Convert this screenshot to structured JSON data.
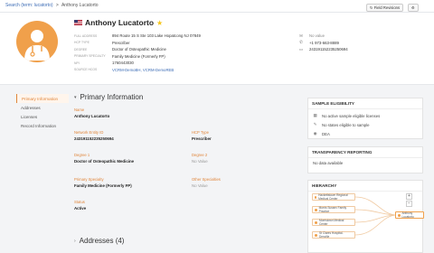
{
  "breadcrumb": {
    "search_link": "Search (term: lucatorto)",
    "separator": ">",
    "current": "Anthony Lucatorto"
  },
  "toolbar": {
    "field_revisions": "Field Revisions",
    "settings_icon": "gear-icon"
  },
  "profile": {
    "name": "Anthony Lucatorto",
    "info": [
      {
        "label": "Full Address",
        "value": "894 Route 15 S Ste 103 Lake Hopatcong NJ 07849",
        "link": false
      },
      {
        "label": "HCP Type",
        "value": "Prescriber",
        "link": false
      },
      {
        "label": "Degree",
        "value": "Doctor of Osteopathic Medicine",
        "link": false
      },
      {
        "label": "Primary Specialty",
        "value": "Family Medicine (Formerly FP)",
        "link": false
      },
      {
        "label": "NPI",
        "value": "1760443030",
        "link": false
      },
      {
        "label": "Source HCOs",
        "value": "VCRM-DemoBH, VCRM-DemoREB",
        "link": true
      }
    ],
    "contact": [
      {
        "icon": "email-icon",
        "glyph": "✉",
        "value": "No value",
        "muted": true
      },
      {
        "icon": "phone-icon",
        "glyph": "✆",
        "value": "+1 973-663-8889",
        "muted": false
      },
      {
        "icon": "id-icon",
        "glyph": "▭",
        "value": "243191152235250694",
        "muted": false
      }
    ]
  },
  "nav": [
    "Primary Information",
    "Addresses",
    "Licenses",
    "Record Information"
  ],
  "primary": {
    "title": "Primary Information",
    "fields": [
      {
        "label": "Name",
        "value": "Anthony Lucatorto"
      },
      {
        "label": "Network Entity ID",
        "value": "243191152235250694"
      },
      {
        "label": "HCP Type",
        "value": "Prescriber"
      },
      {
        "label": "Degree 1",
        "value": "Doctor of Osteopathic Medicine"
      },
      {
        "label": "Degree 2",
        "value": "No Value"
      },
      {
        "label": "Primary Specialty",
        "value": "Family Medicine (Formerly FP)"
      },
      {
        "label": "Other Specialties",
        "value": "No Value"
      },
      {
        "label": "Status",
        "value": "Active"
      }
    ]
  },
  "eligibility": {
    "title": "SAMPLE ELIGIBILITY",
    "rows": [
      {
        "icon": "license-icon",
        "glyph": "▦",
        "text": "No active sample eligible licenses"
      },
      {
        "icon": "pen-icon",
        "glyph": "✎",
        "text": "No states eligible to sample"
      },
      {
        "icon": "dea-icon",
        "glyph": "◉",
        "text": "DEA"
      }
    ]
  },
  "transparency": {
    "title": "TRANSPARENCY REPORTING",
    "text": "No data available"
  },
  "hierarchy": {
    "title": "HIERARCHY",
    "nodes": [
      "Hackettstown Regional Medical Center",
      "Morris Sussex Family Practice",
      "Morristown Medical Center",
      "St Clares Hospital-Denville"
    ],
    "target": "Anthony Lucatorto",
    "zoom_in": "+",
    "zoom_out": "−"
  },
  "addresses": {
    "title": "Addresses (4)"
  },
  "colors": {
    "accent": "#e0853a",
    "link": "#3b6bb5",
    "avatar": "#f0a04b"
  }
}
